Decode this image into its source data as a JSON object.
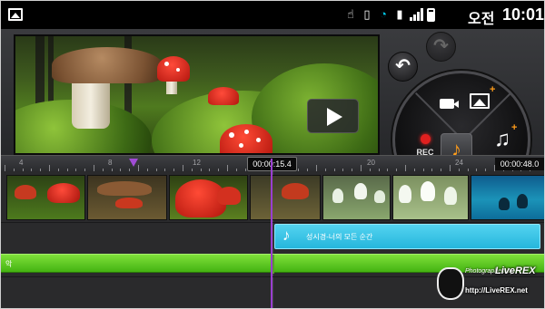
{
  "status_bar": {
    "ampm": "오전",
    "time": "10:01"
  },
  "ruler": {
    "labels": [
      "4",
      "8",
      "12",
      "20",
      "24"
    ],
    "current_time": "00:00:15.4",
    "total_time": "00:00:48.0"
  },
  "timeline": {
    "audio_clip_title": "성시경-너의 모든 순간",
    "bgm_label": "악"
  },
  "watermark": {
    "photographed_by": "Photographed by",
    "brand": "LiveREX",
    "url": "http://LiveREX.net"
  },
  "colors": {
    "accent_orange": "#ff9c1a",
    "playhead_purple": "#9a3ed1",
    "audio_clip_blue": "#25b6dc",
    "bgm_green": "#44b312",
    "rec_red": "#e0201f"
  },
  "icons": [
    "gallery-icon",
    "touch-icon",
    "screen-icon",
    "wifi-icon",
    "sim-icon",
    "signal-icon",
    "battery-icon",
    "undo-icon",
    "redo-icon",
    "camcorder-icon",
    "image-icon",
    "record-icon",
    "music-note-icon",
    "add-music-icon",
    "play-icon"
  ]
}
